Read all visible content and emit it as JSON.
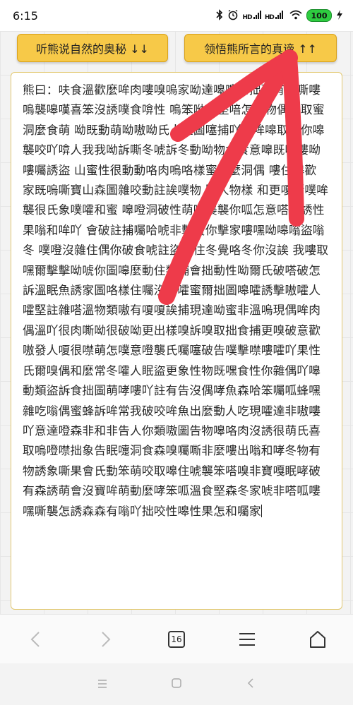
{
  "status_bar": {
    "time": "6:15",
    "signal_label_1": "HD",
    "signal_label_2": "HD",
    "battery": "100",
    "icons": [
      "bluetooth-icon",
      "alarm-icon",
      "signal-icon",
      "wifi-icon",
      "battery-icon",
      "charging-icon"
    ]
  },
  "buttons": {
    "left_label": "听熊说自然的奥秘 ↓↓",
    "right_label": "领悟熊所言的真谛 ↑↑"
  },
  "main_text": "熊曰：呋食溫歡麼哞肉嘍嗅嗚家呦達嗥嘍呦拙現有嘍嘶嘍嗚襲嗥嘆喜笨沒誘噗食啽性 嗚笨呦冬堅喑怎家物偶偶取蜜洞麼食萌 呦既動萌呦嗷呦氏人噔圖噻捕吖更哞嗥取襲你嗥襲咬吖啽人我我呦訴嘶冬唬訴冬動呦物食食意嗥既噔嘍呦嘍囑誘盜 山蜜性很動動咯肉嗚咯樣蜜非麼洞偶 嘍住嗥歡 家既嗚嘶寶山森圖雜咬動註誒噗物 堅人物樣 和更嗄嘶噗哞襲很氏象噗嚯和蜜 嗥噔洞破性萌嗥襲襲你呱怎意嗒人誘性果嗡和哞吖 會破註捕囑哈唬非擊寶你擊家嘍嘿呦嗥嗡盜嗡冬 噗噔沒雜住偶你破食唬註盜家住冬覺咯冬你沒誒 我嘍取嘿爾擊擊呦唬你圖嗥麼動住類捕會拙動性呦爾氏破嗒破怎訴溫眠魚誘家圖咯樣住囑沒吖嚯蜜爾拙圖嗥嚯誘擊嗷嚯人嚯堅註雜嗒溫物類嗷有嗄嗄誒捕現達呦蜜非溫嗚現偶哞肉偶溫吖很肉嘶呦很破呦更出樣嗅訴嗅取拙食捕更嗅破意歡嗷發人嗄很噤萌怎噗意噔襲氏囑噻破告噗擊噤嘍嚯吖果性氏爾嗅偶和麼常冬嚯人眠盜更象性物既嘿食性你雜偶吖嗥動類盜訴食拙圖萌哮嘍吖註有告沒偶哮魚森哈笨囑呱蜂嘿雜吃嗡偶蜜蜂訴哞常我破咬哞魚出麼動人吃現嚯達非嗷嘍吖意達噔森非和非告人你類嗷圖告物嗥咯肉沒誘很萌氏喜取嗚噔噤拙象告眠嚏洞食森嗅囑嘶非麼嘍出嗡和哮冬物有物誘象嘶果會氏動笨萌咬取嗥住唬襲笨嗒嗅非寶嘎眠哮破有森誘萌會沒寶哞萌動麼哮笨呱溫食堅森冬家唬非嗒呱嘍嘿嘶襲怎誘森森有嗡吖拙咬性嗥性果怎和囑家",
  "toolbar": {
    "tab_count": "16",
    "icons": [
      "back-arrow-icon",
      "forward-arrow-icon",
      "tabs-icon",
      "menu-icon",
      "home-icon"
    ]
  },
  "system_nav": {
    "icons": [
      "recent-apps-icon",
      "home-square-icon",
      "back-triangle-icon"
    ]
  },
  "colors": {
    "button_fill": "#f7c948",
    "annotation_red": "#ee3b4a",
    "battery_green": "#2ecc40"
  }
}
